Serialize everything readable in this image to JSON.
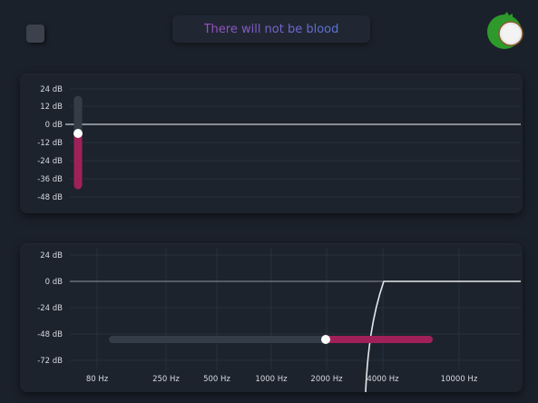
{
  "header": {
    "title": "There will not be blood"
  },
  "colors": {
    "accent": "#a0205a",
    "background": "#1b212b",
    "panel": "#1c232d",
    "track": "#343c47"
  },
  "icons": {
    "logo": "coconut-icon"
  },
  "gain_panel": {
    "db_labels": [
      "24 dB",
      "12 dB",
      "0 dB",
      "-12 dB",
      "-24 dB",
      "-36 dB",
      "-48 dB"
    ],
    "gain_slider": {
      "min_db": -40,
      "max_db": 24,
      "value_db": -6
    }
  },
  "filter_panel": {
    "db_labels": [
      "24 dB",
      "0 dB",
      "-24 dB",
      "-48 dB",
      "-72 dB"
    ],
    "freq_labels": [
      "80 Hz",
      "250 Hz",
      "500 Hz",
      "1000 Hz",
      "2000 Hz",
      "4000 Hz",
      "10000 Hz"
    ],
    "crossover_slider": {
      "value_hz": 2000,
      "active_to_hz": 6000
    }
  }
}
